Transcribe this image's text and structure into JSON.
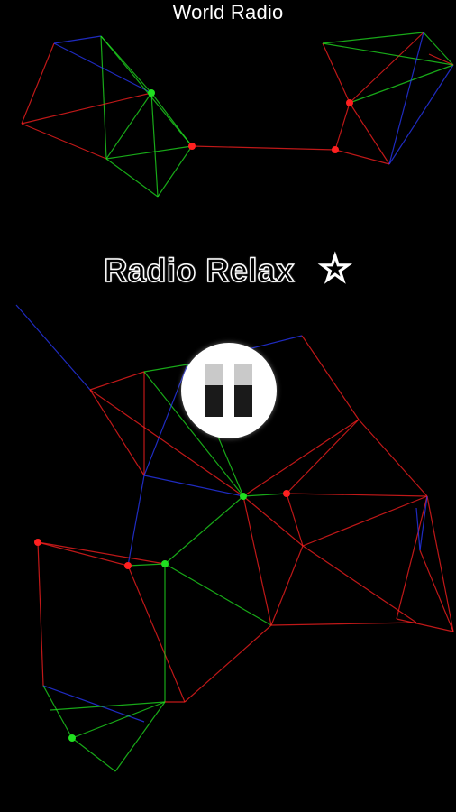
{
  "app": {
    "title": "World Radio"
  },
  "player": {
    "station_name": "Radio Relax",
    "favorite_icon": "star-outline-icon",
    "play_state_icon": "pause-icon"
  },
  "colors": {
    "background": "#000000",
    "network_red": "#ff2020",
    "network_green": "#20e020",
    "network_blue": "#2a3aff"
  }
}
